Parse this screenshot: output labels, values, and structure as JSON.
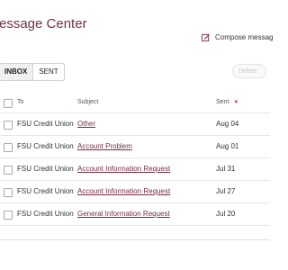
{
  "page": {
    "title": "essage Center"
  },
  "compose": {
    "label": "Compose messag"
  },
  "tabs": [
    {
      "label": "INBOX",
      "active": true
    },
    {
      "label": "SENT",
      "active": false
    }
  ],
  "actions": {
    "delete_label": "Delete"
  },
  "table": {
    "headers": {
      "to": "To",
      "subject": "Subject",
      "sent": "Sent"
    },
    "rows": [
      {
        "to": "FSU Credit Union",
        "subject": "Other",
        "sent": "Aug 04"
      },
      {
        "to": "FSU Credit Union",
        "subject": "Account Problem",
        "sent": "Aug 01"
      },
      {
        "to": "FSU Credit Union",
        "subject": "Account Information Request",
        "sent": "Jul 31"
      },
      {
        "to": "FSU Credit Union",
        "subject": "Account Information Request",
        "sent": "Jul 27"
      },
      {
        "to": "FSU Credit Union",
        "subject": "General Information Request",
        "sent": "Jul 20"
      }
    ]
  },
  "colors": {
    "brand": "#782f40",
    "sort_arrow": "#c0392b"
  },
  "icons": {
    "compose": "pencil-square-icon",
    "sort": "sort-desc-icon"
  }
}
